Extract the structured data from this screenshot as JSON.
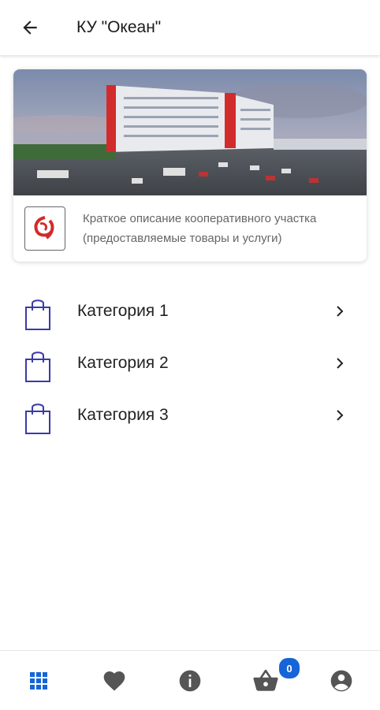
{
  "appbar": {
    "title": "КУ \"Океан\"",
    "back_icon": "arrow-left-icon"
  },
  "card": {
    "image_desc": "building-photo",
    "description": "Краткое описание кооперативного участка (предоставляемые товары и услуги)",
    "logo_icon": "ocean-logo-icon"
  },
  "categories": [
    {
      "label": "Категория 1",
      "icon": "shopping-bag-icon"
    },
    {
      "label": "Категория 2",
      "icon": "shopping-bag-icon"
    },
    {
      "label": "Категория 3",
      "icon": "shopping-bag-icon"
    }
  ],
  "bottom_nav": {
    "items": [
      {
        "icon": "grid-icon",
        "active": true
      },
      {
        "icon": "heart-icon",
        "active": false
      },
      {
        "icon": "info-icon",
        "active": false
      },
      {
        "icon": "basket-icon",
        "active": false
      },
      {
        "icon": "account-icon",
        "active": false
      }
    ],
    "cart_count": "0"
  },
  "colors": {
    "accent": "#1565d8",
    "bag": "#3a3aa8",
    "icon_gray": "#555555"
  }
}
